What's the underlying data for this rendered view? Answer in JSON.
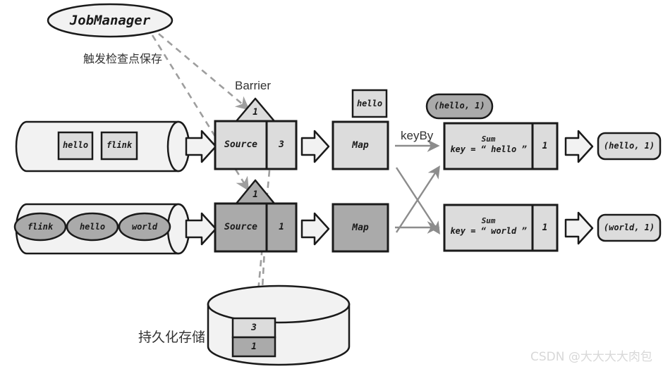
{
  "diagram": {
    "title_nodes": {
      "jobmanager": "JobManager",
      "trigger_label": "触发检查点保存",
      "barrier_label": "Barrier",
      "keyby_label": "keyBy",
      "storage_label": "持久化存储"
    },
    "streams": [
      {
        "name": "upper-input-stream",
        "items": [
          "hello",
          "flink"
        ],
        "shape": "square"
      },
      {
        "name": "lower-input-stream",
        "items": [
          "flink",
          "hello",
          "world"
        ],
        "shape": "ellipse"
      }
    ],
    "barriers": [
      {
        "name": "upper-barrier",
        "id": "1"
      },
      {
        "name": "lower-barrier",
        "id": "1"
      }
    ],
    "operators": {
      "upper_source": {
        "label": "Source",
        "state": "3"
      },
      "lower_source": {
        "label": "Source",
        "state": "1"
      },
      "upper_map": {
        "label": "Map"
      },
      "lower_map": {
        "label": "Map"
      },
      "upper_sum": {
        "label": "Sum",
        "key_line": "key = “ hello ”",
        "state": "1"
      },
      "lower_sum": {
        "label": "Sum",
        "key_line": "key = “ world ”",
        "state": "1"
      }
    },
    "tokens": {
      "map_input_hello": "hello",
      "sum_input_hello": "(hello, 1)"
    },
    "outputs": [
      {
        "name": "upper-output",
        "label": "(hello, 1)"
      },
      {
        "name": "lower-output",
        "label": "(world, 1)"
      }
    ],
    "storage": {
      "label": "持久化存储",
      "cells": [
        {
          "value": "3",
          "tone": "light"
        },
        {
          "value": "1",
          "tone": "dark"
        }
      ]
    },
    "watermark": "CSDN @大大大大肉包",
    "colors": {
      "light_fill": "#dcdcdc",
      "mid_fill": "#aaaaaa",
      "cylinder_fill": "#f2f2f2",
      "stroke": "#1a1a1a",
      "dashed": "#9e9e9e",
      "arrow_gray": "#8c8c8c",
      "watermark": "#d8d8d8"
    }
  }
}
